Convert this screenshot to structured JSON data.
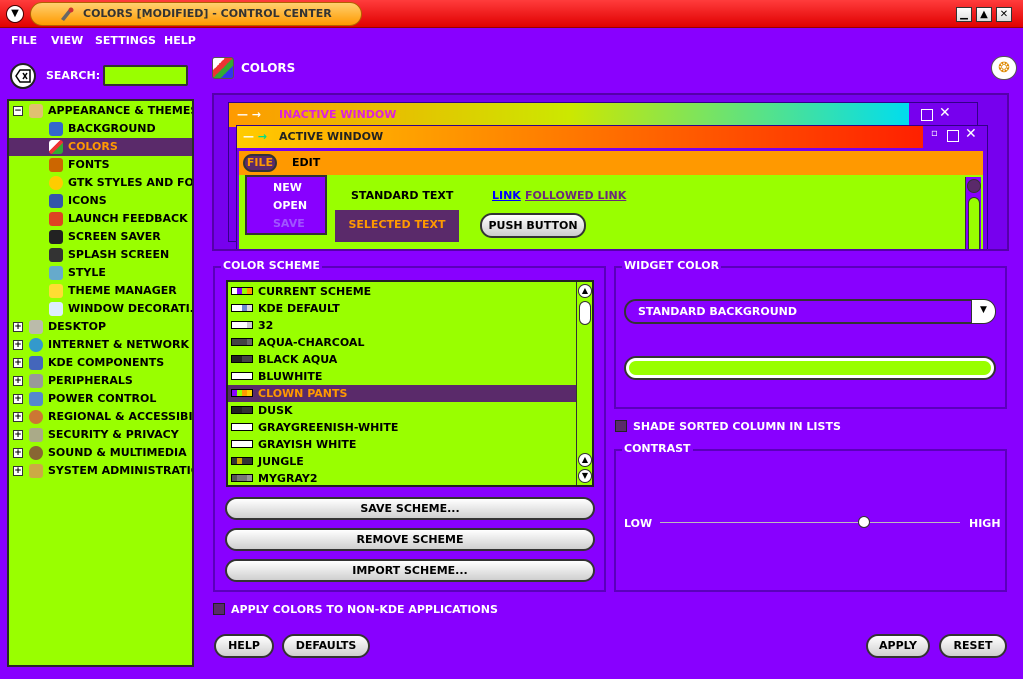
{
  "window": {
    "title": "COLORS [MODIFIED] - CONTROL CENTER",
    "sysmenu_icon": "down-arrow-icon",
    "controls": [
      "minimize",
      "maximize",
      "close"
    ]
  },
  "menubar": {
    "items": [
      "FILE",
      "VIEW",
      "SETTINGS",
      "HELP"
    ]
  },
  "search": {
    "label": "SEARCH:",
    "value": ""
  },
  "sidebar": {
    "items": [
      {
        "label": "APPEARANCE & THEMES",
        "level": 0,
        "expander": "−"
      },
      {
        "label": "BACKGROUND",
        "level": 1
      },
      {
        "label": "COLORS",
        "level": 1,
        "selected": true
      },
      {
        "label": "FONTS",
        "level": 1
      },
      {
        "label": "GTK STYLES AND FO...",
        "level": 1
      },
      {
        "label": "ICONS",
        "level": 1
      },
      {
        "label": "LAUNCH FEEDBACK",
        "level": 1
      },
      {
        "label": "SCREEN SAVER",
        "level": 1
      },
      {
        "label": "SPLASH SCREEN",
        "level": 1
      },
      {
        "label": "STYLE",
        "level": 1
      },
      {
        "label": "THEME MANAGER",
        "level": 1
      },
      {
        "label": "WINDOW DECORATI...",
        "level": 1
      },
      {
        "label": "DESKTOP",
        "level": 0,
        "expander": "+"
      },
      {
        "label": "INTERNET & NETWORK",
        "level": 0,
        "expander": "+"
      },
      {
        "label": "KDE COMPONENTS",
        "level": 0,
        "expander": "+"
      },
      {
        "label": "PERIPHERALS",
        "level": 0,
        "expander": "+"
      },
      {
        "label": "POWER CONTROL",
        "level": 0,
        "expander": "+"
      },
      {
        "label": "REGIONAL & ACCESSIBI...",
        "level": 0,
        "expander": "+"
      },
      {
        "label": "SECURITY & PRIVACY",
        "level": 0,
        "expander": "+"
      },
      {
        "label": "SOUND & MULTIMEDIA",
        "level": 0,
        "expander": "+"
      },
      {
        "label": "SYSTEM ADMINISTRATION",
        "level": 0,
        "expander": "+"
      }
    ]
  },
  "page": {
    "title": "COLORS"
  },
  "preview": {
    "inactive_title": "INACTIVE WINDOW",
    "active_title": "ACTIVE WINDOW",
    "menu_file": "FILE",
    "menu_edit": "EDIT",
    "popup_items": [
      "NEW",
      "OPEN",
      "SAVE"
    ],
    "standard_text": "STANDARD TEXT",
    "selected_text": "SELECTED TEXT",
    "link": "LINK",
    "followed_link": "FOLLOWED LINK",
    "push_button": "PUSH BUTTON"
  },
  "color_scheme": {
    "title": "COLOR SCHEME",
    "schemes": [
      {
        "name": "CURRENT SCHEME",
        "swatch": [
          "#ffffff",
          "#8800ff",
          "#99ff00",
          "#ff9900"
        ]
      },
      {
        "name": "KDE DEFAULT",
        "swatch": [
          "#ffffff",
          "#ffffff",
          "#6a8ad0",
          "#dcdcdc"
        ]
      },
      {
        "name": "32",
        "swatch": [
          "#ffffff",
          "#ffffff",
          "#ffffff",
          "#cccccc"
        ]
      },
      {
        "name": "AQUA-CHARCOAL",
        "swatch": [
          "#444444",
          "#444444",
          "#444444",
          "#666666"
        ]
      },
      {
        "name": "BLACK AQUA",
        "swatch": [
          "#222222",
          "#222222",
          "#444444",
          "#444444"
        ]
      },
      {
        "name": "BLUWHITE",
        "swatch": [
          "#ffffff",
          "#ffffff",
          "#ffffff",
          "#ffffff"
        ]
      },
      {
        "name": "CLOWN PANTS",
        "swatch": [
          "#8800ff",
          "#99ff00",
          "#ff9900",
          "#ffcc00"
        ],
        "selected": true
      },
      {
        "name": "DUSK",
        "swatch": [
          "#222222",
          "#222222",
          "#333333",
          "#333333"
        ]
      },
      {
        "name": "GRAYGREENISH-WHITE",
        "swatch": [
          "#ffffff",
          "#ffffff",
          "#ffffff",
          "#ffffff"
        ]
      },
      {
        "name": "GRAYISH WHITE",
        "swatch": [
          "#ffffff",
          "#ffffff",
          "#ffffff",
          "#ffffff"
        ]
      },
      {
        "name": "JUNGLE",
        "swatch": [
          "#333333",
          "#ccaa00",
          "#333333",
          "#333333"
        ]
      },
      {
        "name": "MYGRAY2",
        "swatch": [
          "#555555",
          "#777777",
          "#777777",
          "#999999"
        ]
      }
    ],
    "save_button": "SAVE SCHEME...",
    "remove_button": "REMOVE SCHEME",
    "import_button": "IMPORT SCHEME..."
  },
  "widget_color": {
    "title": "WIDGET COLOR",
    "selected": "STANDARD BACKGROUND",
    "color": "#99ff00"
  },
  "shade_sorted": "SHADE SORTED COLUMN IN LISTS",
  "contrast": {
    "title": "CONTRAST",
    "low": "LOW",
    "high": "HIGH",
    "value_fraction": 0.68
  },
  "apply_nonkde": "APPLY COLORS TO NON-KDE APPLICATIONS",
  "buttons": {
    "help": "HELP",
    "defaults": "DEFAULTS",
    "apply": "APPLY",
    "reset": "RESET"
  },
  "colors": {
    "background": "#8800ff",
    "list_bg": "#99ff00",
    "selection_bg": "#5a2a6a",
    "selection_fg": "#ff9900",
    "titlebar": "#ee1111"
  }
}
